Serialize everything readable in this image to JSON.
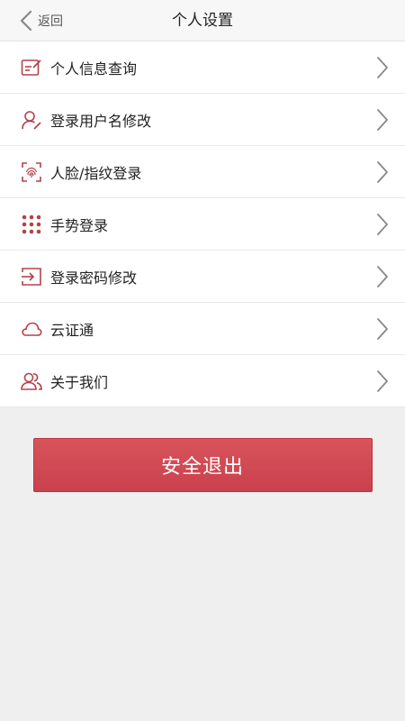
{
  "header": {
    "back_label": "返回",
    "title": "个人设置"
  },
  "menu": {
    "items": [
      {
        "label": "个人信息查询",
        "icon": "profile-edit-icon"
      },
      {
        "label": "登录用户名修改",
        "icon": "user-edit-icon"
      },
      {
        "label": "人脸/指纹登录",
        "icon": "fingerprint-icon"
      },
      {
        "label": "手势登录",
        "icon": "gesture-dots-icon"
      },
      {
        "label": "登录密码修改",
        "icon": "login-arrow-icon"
      },
      {
        "label": "云证通",
        "icon": "cloud-icon"
      },
      {
        "label": "关于我们",
        "icon": "users-icon"
      }
    ]
  },
  "logout": {
    "label": "安全退出"
  },
  "colors": {
    "accent": "#c8414c",
    "icon": "#b3424b"
  }
}
